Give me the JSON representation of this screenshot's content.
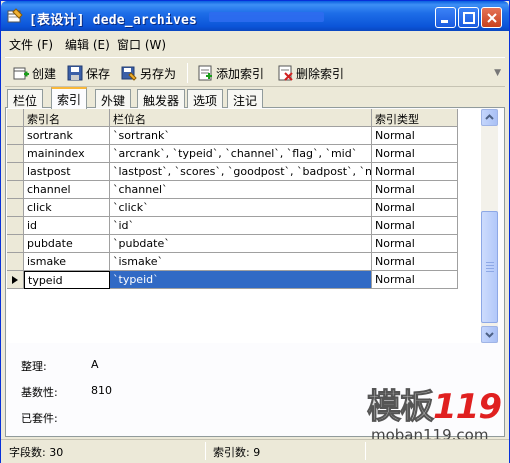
{
  "window": {
    "title": "[表设计] dede_archives",
    "icons": [
      "table-design-icon",
      "minimize-icon",
      "maximize-icon",
      "close-icon"
    ]
  },
  "menu": {
    "items": [
      "文件 (F)",
      "编辑 (E)",
      "窗口 (W)"
    ]
  },
  "toolbar": {
    "buttons": [
      {
        "label": "创建",
        "icon": "create-icon"
      },
      {
        "label": "保存",
        "icon": "save-icon"
      },
      {
        "label": "另存为",
        "icon": "save-as-icon"
      },
      {
        "label": "添加索引",
        "icon": "add-index-icon"
      },
      {
        "label": "删除索引",
        "icon": "delete-index-icon"
      }
    ]
  },
  "tabs": [
    {
      "label": "栏位",
      "active": false
    },
    {
      "label": "索引",
      "active": true
    },
    {
      "label": "外键",
      "active": false
    },
    {
      "label": "触发器",
      "active": false
    },
    {
      "label": "选项",
      "active": false
    },
    {
      "label": "注记",
      "active": false
    }
  ],
  "grid": {
    "columns": [
      "索引名",
      "栏位名",
      "索引类型"
    ],
    "rows": [
      {
        "name": "sortrank",
        "fields": "`sortrank`",
        "type": "Normal"
      },
      {
        "name": "mainindex",
        "fields": "`arcrank`, `typeid`, `channel`, `flag`, `mid`",
        "type": "Normal"
      },
      {
        "name": "lastpost",
        "fields": "`lastpost`, `scores`, `goodpost`, `badpost`, `notpost`",
        "type": "Normal"
      },
      {
        "name": "channel",
        "fields": "`channel`",
        "type": "Normal"
      },
      {
        "name": "click",
        "fields": "`click`",
        "type": "Normal"
      },
      {
        "name": "id",
        "fields": "`id`",
        "type": "Normal"
      },
      {
        "name": "pubdate",
        "fields": "`pubdate`",
        "type": "Normal"
      },
      {
        "name": "ismake",
        "fields": "`ismake`",
        "type": "Normal"
      },
      {
        "name": "typeid",
        "fields": "`typeid`",
        "type": "Normal",
        "selected": true
      }
    ]
  },
  "properties": [
    {
      "label": "整理:",
      "value": "A"
    },
    {
      "label": "基数性:",
      "value": "810"
    },
    {
      "label": "已套件:",
      "value": ""
    }
  ],
  "status": {
    "fields_count": "字段数: 30",
    "index_count": "索引数: 9"
  },
  "watermark": {
    "logo_part1": "模板",
    "logo_part2": "119",
    "url": "moban119.com"
  },
  "colors": {
    "title_bar": "#0b54d8",
    "selection": "#316ac5",
    "active_tab_accent": "#f9b83a",
    "watermark_red": "#e02020"
  }
}
